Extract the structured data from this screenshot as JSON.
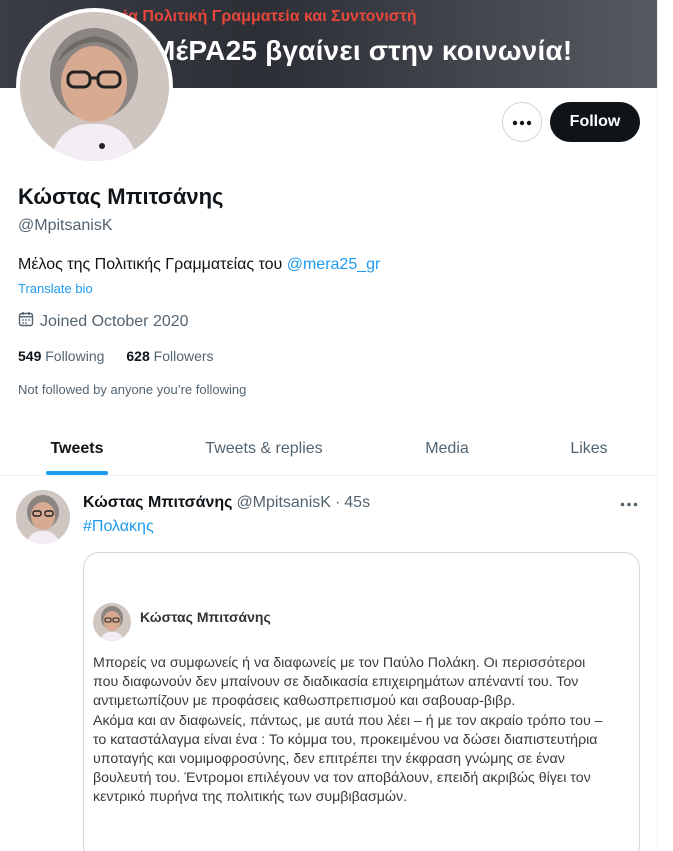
{
  "banner": {
    "line1": "νέα Πολιτική Γραμματεία και Συντονιστή",
    "line2": "ΜέΡΑ25 βγαίνει στην κοινωνία!"
  },
  "profile": {
    "name": "Κώστας Μπιτσάνης",
    "handle": "@MpitsanisK",
    "bio_text": "Μέλος της Πολιτικής Γραμματείας του ",
    "bio_link": "@mera25_gr",
    "translate_bio": "Translate bio",
    "joined": "Joined October 2020",
    "following_count": "549",
    "following_label": "Following",
    "followers_count": "628",
    "followers_label": "Followers",
    "not_followed": "Not followed by anyone you’re following"
  },
  "actions": {
    "follow_label": "Follow",
    "more_icon": "more-horizontal-icon"
  },
  "tabs": [
    {
      "label": "Tweets",
      "active": true
    },
    {
      "label": "Tweets & replies",
      "active": false
    },
    {
      "label": "Media",
      "active": false
    },
    {
      "label": "Likes",
      "active": false
    }
  ],
  "tweet": {
    "author_name": "Κώστας Μπιτσάνης",
    "author_handle": "@MpitsanisK",
    "separator": "·",
    "time": "45s",
    "hashtag": "#Πολακης",
    "media": {
      "author_name": "Κώστας Μπιτσάνης",
      "lines": [
        "Μπορείς να συμφωνείς ή να διαφωνείς με τον Παύλο Πολάκη. Οι περισσότεροι",
        "που διαφωνούν δεν μπαίνουν σε διαδικασία επιχειρημάτων απέναντί του. Τον",
        "αντιμετωπίζουν με προφάσεις καθωσπρεπισμού και σαβουαρ-βιβρ.",
        "Ακόμα και αν διαφωνείς, πάντως, με αυτά που λέει – ή με τον ακραίο τρόπο του –",
        "το καταστάλαγμα είναι ένα : Το κόμμα του, προκειμένου να δώσει διαπιστευτήρια",
        "υποταγής και νομιμοφροσύνης, δεν επιτρέπει την έκφραση γνώμης σε έναν",
        "βουλευτή του. Έντρομοι επιλέγουν να τον αποβάλουν, επειδή ακριβώς θίγει τον",
        "κεντρικό πυρήνα της πολιτικής των συμβιβασμών."
      ]
    }
  },
  "colors": {
    "accent": "#1d9bf0",
    "text": "#0f1419",
    "secondary": "#536471",
    "banner_red": "#e8463a"
  }
}
